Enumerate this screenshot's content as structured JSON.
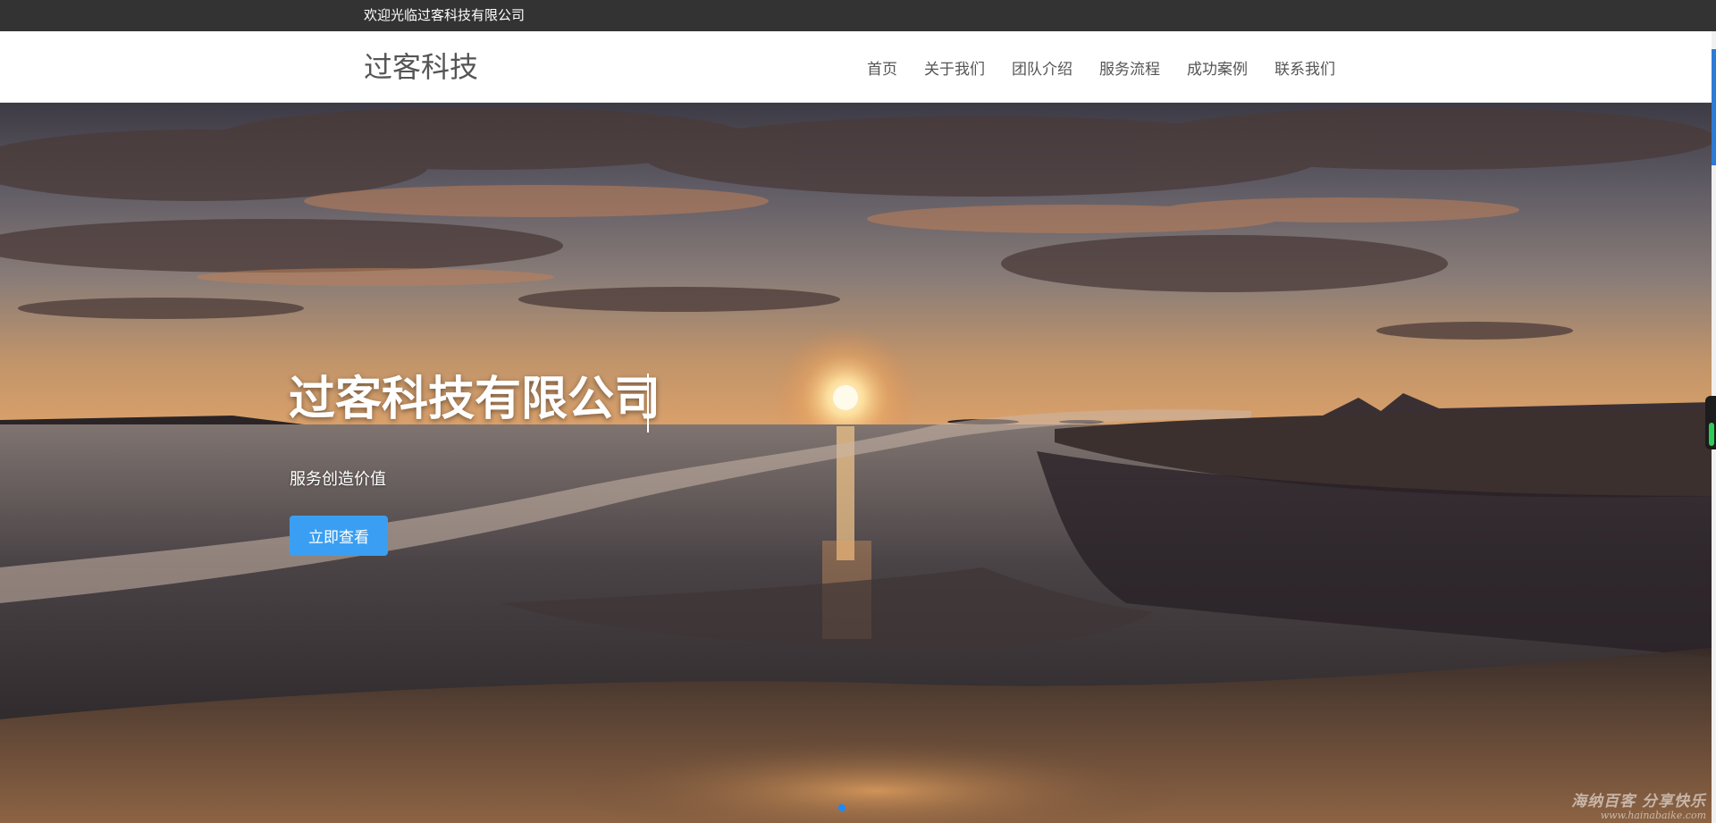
{
  "topbar": {
    "welcome_text": "欢迎光临过客科技有限公司"
  },
  "navbar": {
    "brand": "过客科技",
    "menu": [
      {
        "label": "首页"
      },
      {
        "label": "关于我们"
      },
      {
        "label": "团队介绍"
      },
      {
        "label": "服务流程"
      },
      {
        "label": "成功案例"
      },
      {
        "label": "联系我们"
      }
    ]
  },
  "hero": {
    "title": "过客科技有限公司",
    "subtitle": "服务创造价值",
    "button_label": "立即查看",
    "background_image": "beach-sunset-photo",
    "active_slide_color": "#1e88ff"
  },
  "watermark": {
    "main": "海纳百客 分享快乐",
    "url": "www.hainabaike.com"
  },
  "colors": {
    "topbar_bg": "#333333",
    "button_bg": "#3a9ff2",
    "nav_text": "#555555"
  }
}
